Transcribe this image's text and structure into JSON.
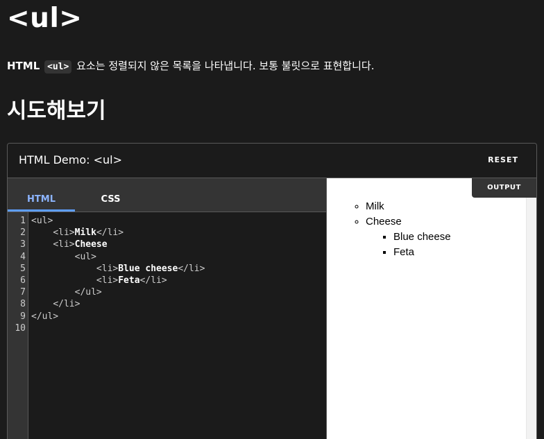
{
  "page": {
    "title": "<ul>",
    "intro": {
      "prefix": "HTML",
      "code": "<ul>",
      "suffix": "요소는 정렬되지 않은 목록을 나타냅니다. 보통 불릿으로 표현합니다."
    },
    "section_title": "시도해보기"
  },
  "demo": {
    "title": "HTML Demo: <ul>",
    "reset_label": "RESET",
    "tabs": [
      {
        "label": "HTML",
        "active": true
      },
      {
        "label": "CSS",
        "active": false
      }
    ],
    "line_numbers": [
      "1",
      "2",
      "3",
      "4",
      "5",
      "6",
      "7",
      "8",
      "9",
      "10"
    ],
    "code_lines": [
      {
        "indent": "",
        "open": "<ul>",
        "text": "",
        "close": ""
      },
      {
        "indent": "    ",
        "open": "<li>",
        "text": "Milk",
        "close": "</li>"
      },
      {
        "indent": "    ",
        "open": "<li>",
        "text": "Cheese",
        "close": ""
      },
      {
        "indent": "        ",
        "open": "<ul>",
        "text": "",
        "close": ""
      },
      {
        "indent": "            ",
        "open": "<li>",
        "text": "Blue cheese",
        "close": "</li>"
      },
      {
        "indent": "            ",
        "open": "<li>",
        "text": "Feta",
        "close": "</li>"
      },
      {
        "indent": "        ",
        "open": "</ul>",
        "text": "",
        "close": ""
      },
      {
        "indent": "    ",
        "open": "</li>",
        "text": "",
        "close": ""
      },
      {
        "indent": "",
        "open": "</ul>",
        "text": "",
        "close": ""
      },
      {
        "indent": "",
        "open": "",
        "text": "",
        "close": ""
      }
    ],
    "output_label": "OUTPUT",
    "output_list": {
      "item1": "Milk",
      "item2": "Cheese",
      "nested1": "Blue cheese",
      "nested2": "Feta"
    }
  },
  "colors": {
    "background": "#1b1b1b",
    "panel": "#343434",
    "active_tab": "#8cb4ff",
    "border": "#5a5a5a"
  }
}
